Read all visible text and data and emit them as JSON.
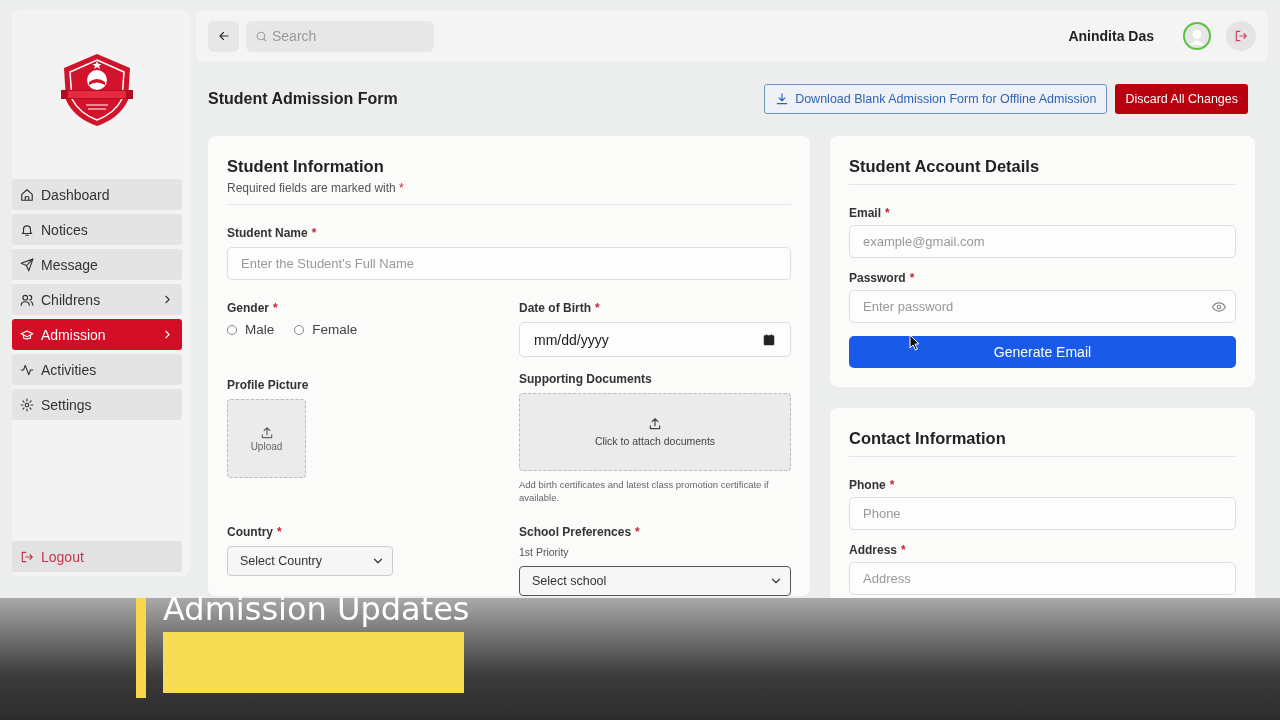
{
  "sidebar": {
    "nav": [
      {
        "label": "Dashboard",
        "selected": false,
        "has_submenu": false
      },
      {
        "label": "Notices",
        "selected": false,
        "has_submenu": false
      },
      {
        "label": "Message",
        "selected": false,
        "has_submenu": false
      },
      {
        "label": "Childrens",
        "selected": false,
        "has_submenu": true
      },
      {
        "label": "Admission",
        "selected": true,
        "has_submenu": true
      },
      {
        "label": "Activities",
        "selected": false,
        "has_submenu": false
      },
      {
        "label": "Settings",
        "selected": false,
        "has_submenu": false
      }
    ],
    "logout": "Logout"
  },
  "topbar": {
    "search": {
      "placeholder": "Search"
    },
    "user": {
      "name": "Anindita Das"
    }
  },
  "page_title": "Student Admission Form",
  "actions": [
    {
      "label": "Download Blank Admission Form for Offline Admission",
      "kind": "outline"
    },
    {
      "label": "Discard All Changes",
      "kind": "danger"
    }
  ],
  "student_info": {
    "title": "Student Information",
    "note": {
      "text": "Required fields are marked with",
      "mark": "*"
    },
    "student_name": {
      "label": "Student Name",
      "mark": "*",
      "placeholder": "Enter the Student's Full Name"
    },
    "gender": {
      "label": "Gender",
      "mark": "*",
      "options": [
        {
          "label": "Male",
          "selected": false
        },
        {
          "label": "Female",
          "selected": false
        }
      ]
    },
    "date_of_birth": {
      "label": "Date of Birth",
      "mark": "*",
      "placeholder": "mm/dd/yyyy"
    },
    "profile_picture": {
      "label": "Profile Picture",
      "upload_label": "Upload"
    },
    "supporting_documents": {
      "label": "Supporting Documents",
      "upload_label": "Click to attach documents",
      "hint": "Add birth certificates and latest class promotion certificate if available."
    },
    "country": {
      "label": "Country",
      "mark": "*",
      "value": "Select Country"
    },
    "school_preferences": {
      "label": "School Preferences",
      "mark": "*",
      "priority_label": "1st Priority",
      "value": "Select school"
    }
  },
  "account": {
    "title": "Student Account Details",
    "email": {
      "label": "Email",
      "mark": "*",
      "placeholder": "example@gmail.com"
    },
    "password": {
      "label": "Password",
      "mark": "*",
      "placeholder": "Enter password"
    },
    "button": "Generate Email"
  },
  "contact": {
    "title": "Contact Information",
    "phone": {
      "label": "Phone",
      "mark": "*",
      "placeholder": "Phone"
    },
    "address": {
      "label": "Address",
      "mark": "*",
      "placeholder": "Address"
    }
  },
  "caption": {
    "title": "Admission Updates"
  }
}
